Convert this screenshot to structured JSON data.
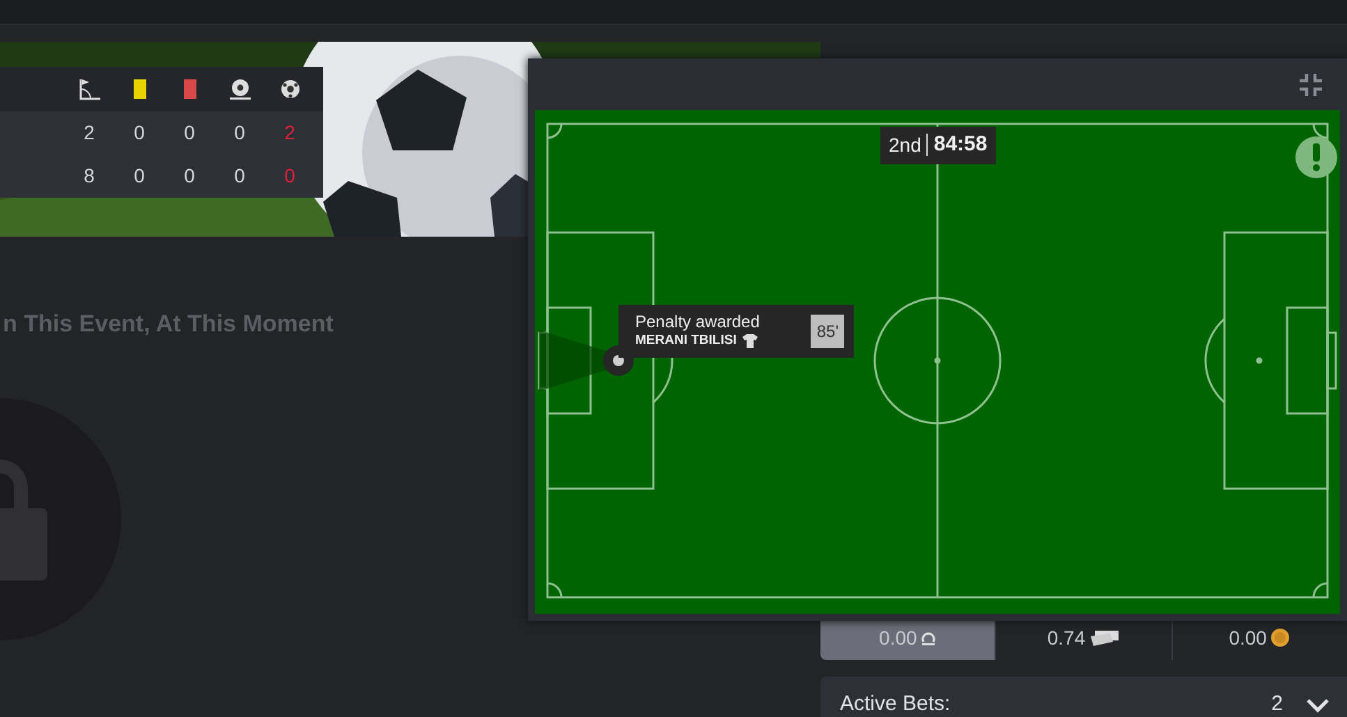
{
  "scoreboard": {
    "columns": [
      {
        "kind": "corners"
      },
      {
        "kind": "yellow_cards"
      },
      {
        "kind": "red_cards"
      },
      {
        "kind": "penalties"
      },
      {
        "kind": "goals"
      }
    ],
    "rows": [
      {
        "values": [
          "2",
          "0",
          "0",
          "0",
          "2"
        ]
      },
      {
        "values": [
          "8",
          "0",
          "0",
          "0",
          "0"
        ]
      }
    ]
  },
  "notice": "n This Event, At This Moment",
  "tracker": {
    "period": "2nd",
    "clock": "84:58",
    "event": {
      "title": "Penalty awarded",
      "team": "MERANI TBILISI",
      "minute": "85'"
    }
  },
  "balances": [
    {
      "amount": "0.00",
      "kind": "bonus",
      "selected": true
    },
    {
      "amount": "0.74",
      "kind": "freebet",
      "selected": false
    },
    {
      "amount": "0.00",
      "kind": "coins",
      "selected": false
    }
  ],
  "active_bets": {
    "label": "Active Bets:",
    "count": "2"
  }
}
